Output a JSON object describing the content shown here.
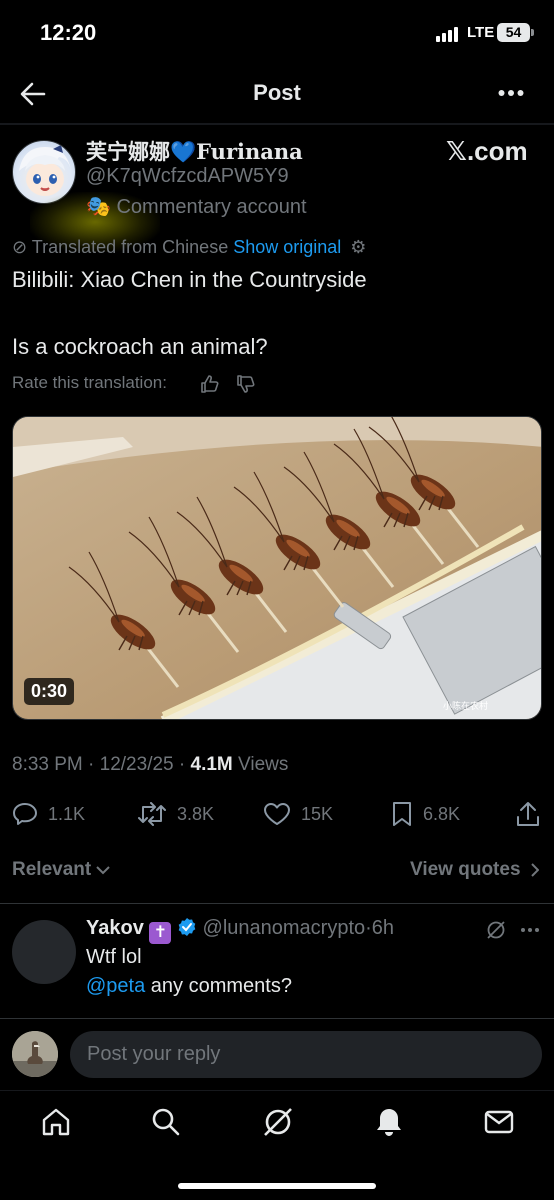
{
  "status_bar": {
    "time": "12:20",
    "network": "LTE",
    "battery": "54"
  },
  "nav": {
    "title": "Post"
  },
  "author": {
    "name": "芙宁娜娜💙Furinana",
    "handle": "@K7qWcfzcdAPW5Y9",
    "label_icon": "comedy-mask-emoji",
    "label": "Commentary account",
    "badge": "𝕏.com"
  },
  "translation": {
    "notice": "Translated from Chinese",
    "show_original": "Show original",
    "rate": "Rate this translation:"
  },
  "post": {
    "lines": [
      "Bilibili: Xiao Chen in the Countryside",
      "Is a cockroach an animal?"
    ],
    "video_duration": "0:30",
    "watermark": "小陈在农村",
    "timestamp": "8:33 PM · 12/23/25 · ",
    "views_count": "4.1M",
    "views_label": "Views"
  },
  "actions": {
    "replies": "1.1K",
    "reposts": "3.8K",
    "likes": "15K",
    "bookmarks": "6.8K"
  },
  "replies_bar": {
    "sort": "Relevant",
    "view_quotes": "View quotes"
  },
  "reply": {
    "name": "Yakov",
    "name_emoji": "✝️",
    "handle": "@lunanomacrypto",
    "time": "6h",
    "line1": "Wtf lol",
    "mention": "@peta",
    "line2_rest": " any comments?"
  },
  "compose": {
    "placeholder": "Post your reply"
  },
  "colors": {
    "accent": "#1d9bf0",
    "background": "#000000",
    "muted": "#71767b",
    "text": "#e7e9ea"
  }
}
